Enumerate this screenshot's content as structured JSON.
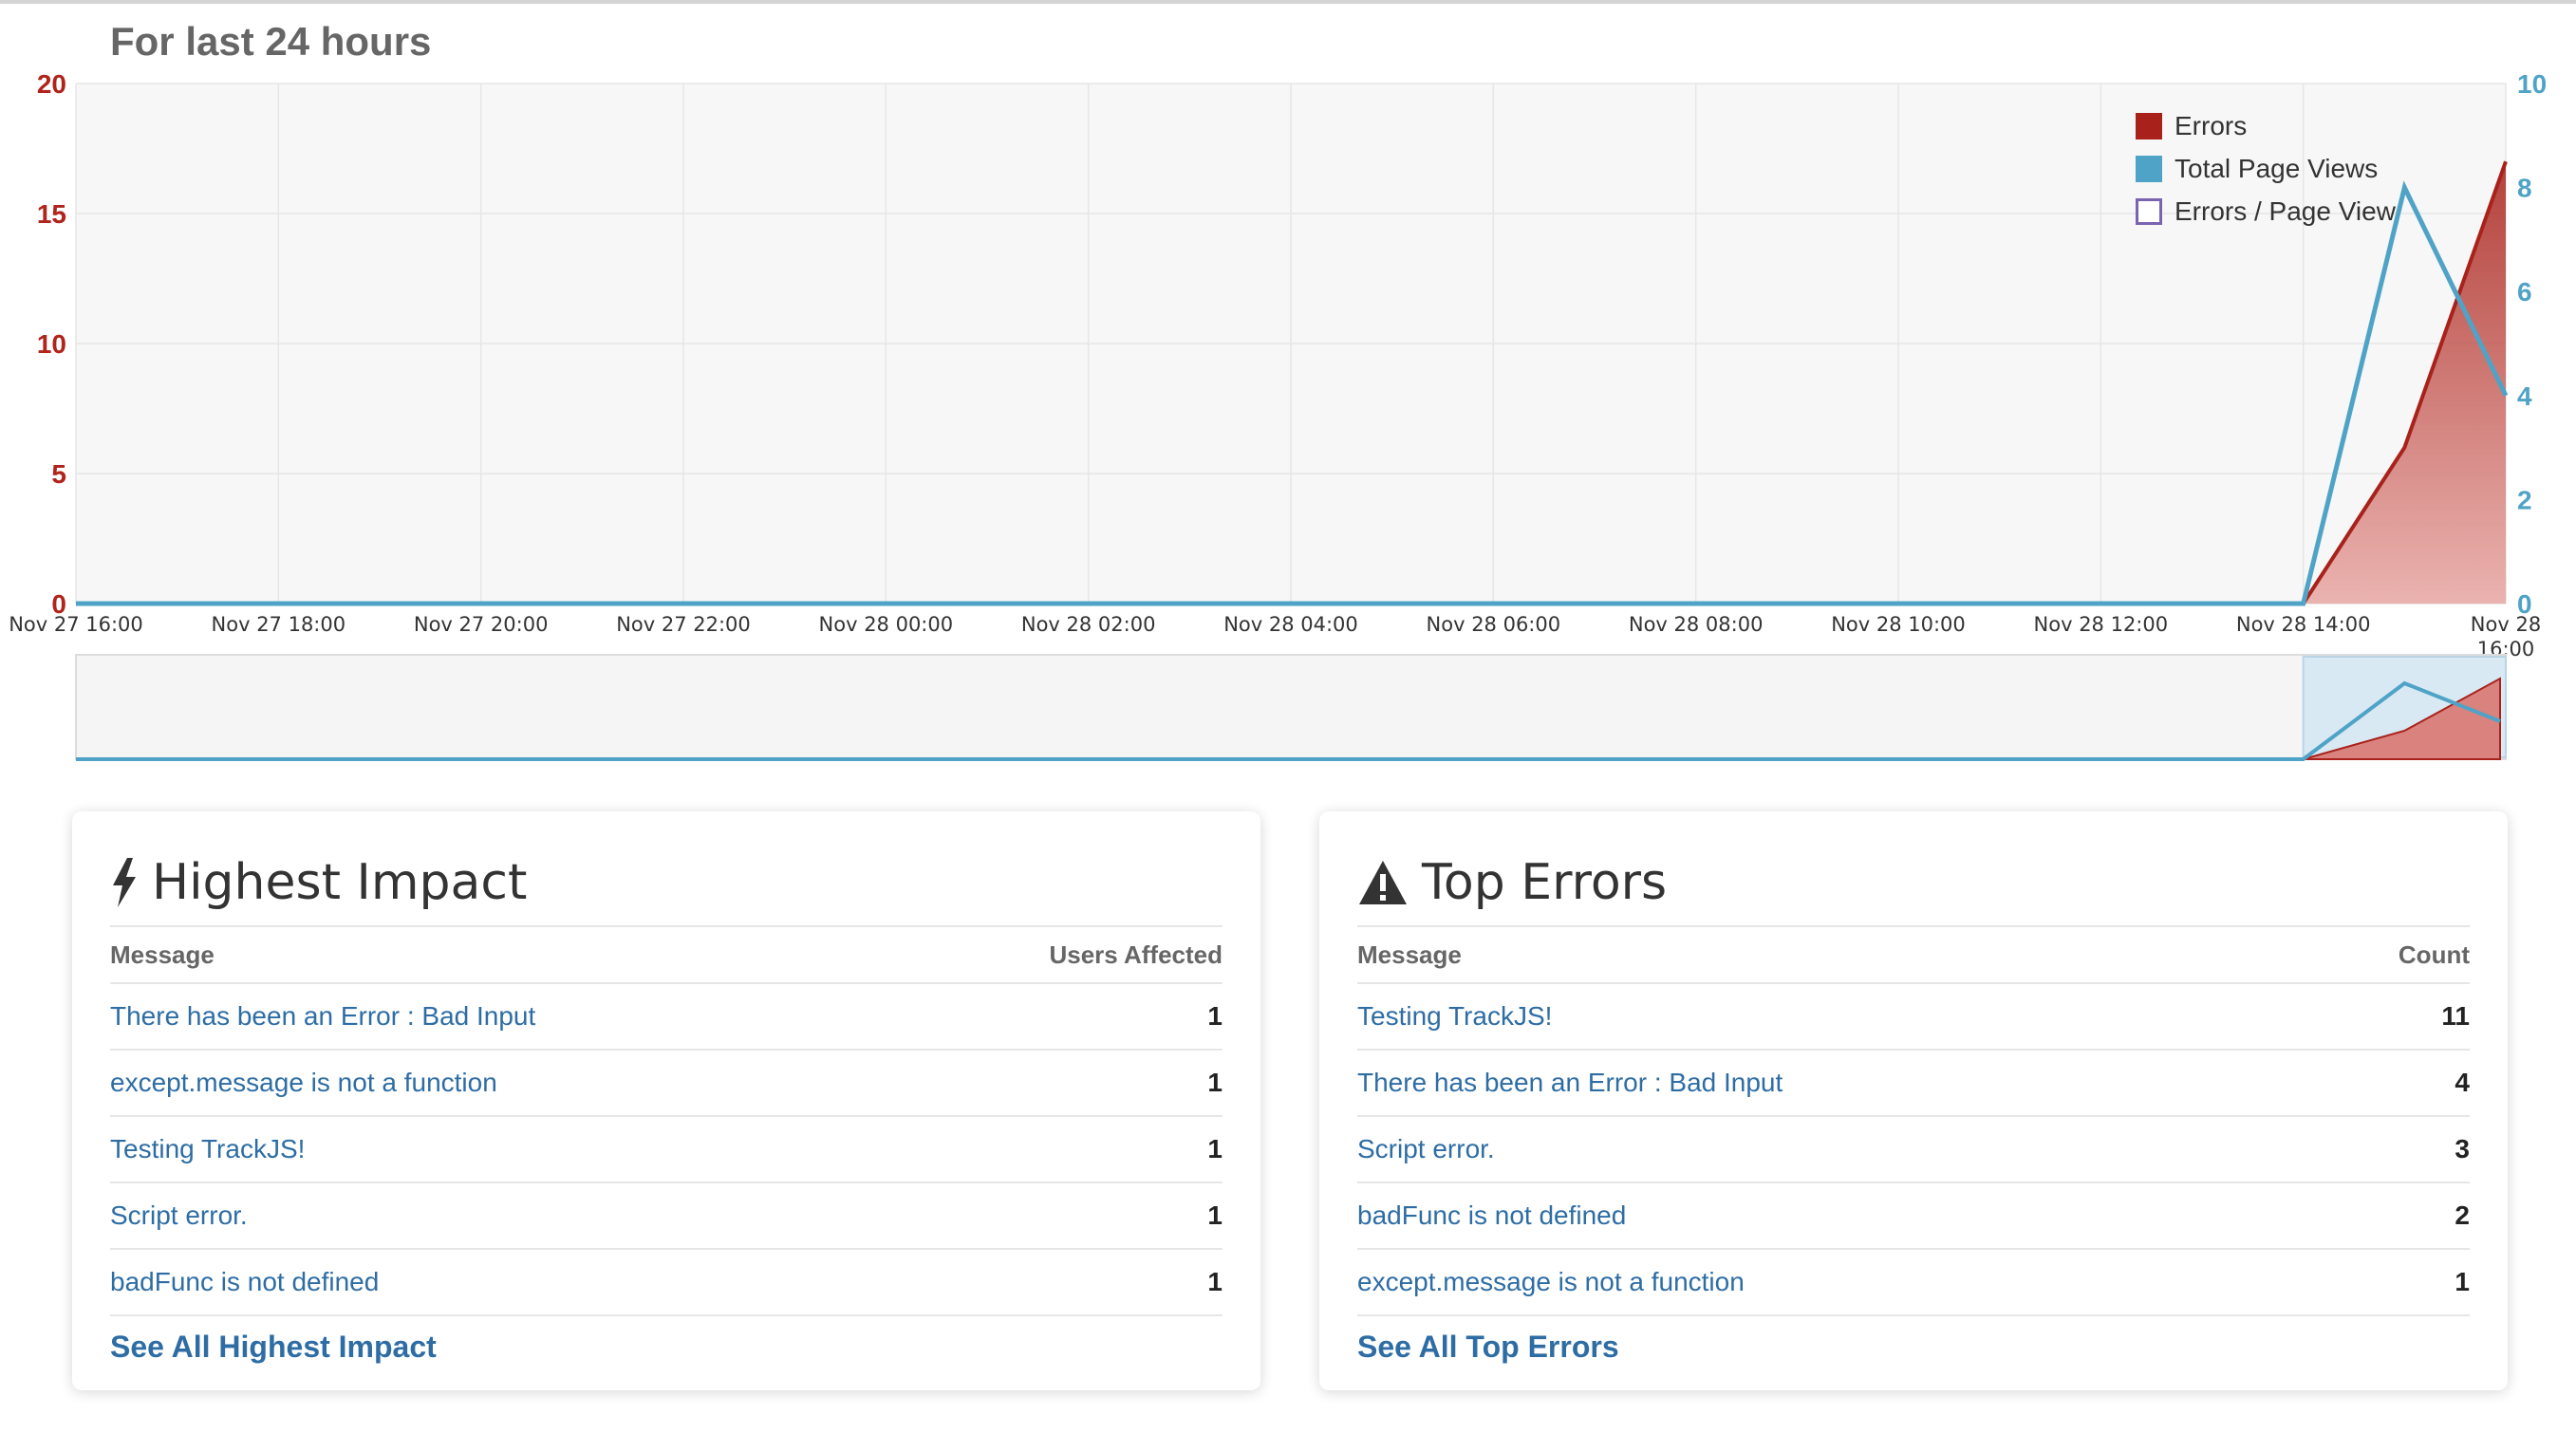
{
  "chart_title": "For last 24 hours",
  "chart_data": {
    "type": "area",
    "x": [
      "Nov 27 16:00",
      "Nov 27 18:00",
      "Nov 27 20:00",
      "Nov 27 22:00",
      "Nov 28 00:00",
      "Nov 28 02:00",
      "Nov 28 04:00",
      "Nov 28 06:00",
      "Nov 28 08:00",
      "Nov 28 10:00",
      "Nov 28 12:00",
      "Nov 28 14:00",
      "Nov 28 15:00",
      "Nov 28 16:00"
    ],
    "tick_labels": [
      "Nov 27 16:00",
      "Nov 27 18:00",
      "Nov 27 20:00",
      "Nov 27 22:00",
      "Nov 28 00:00",
      "Nov 28 02:00",
      "Nov 28 04:00",
      "Nov 28 06:00",
      "Nov 28 08:00",
      "Nov 28 10:00",
      "Nov 28 12:00",
      "Nov 28 14:00",
      "Nov 28 16:00"
    ],
    "left_axis": {
      "ticks": [
        "0",
        "5",
        "10",
        "15",
        "20"
      ],
      "ylim": [
        0,
        20
      ],
      "color": "#b0241c"
    },
    "right_axis": {
      "ticks": [
        "0",
        "2",
        "4",
        "6",
        "8",
        "10"
      ],
      "ylim": [
        0,
        10
      ],
      "color": "#4fa3c6"
    },
    "series": [
      {
        "name": "Errors",
        "color": "#a8221b",
        "axis": "left",
        "style": "area",
        "values": [
          0,
          0,
          0,
          0,
          0,
          0,
          0,
          0,
          0,
          0,
          0,
          0,
          6,
          17
        ]
      },
      {
        "name": "Total Page Views",
        "color": "#4fa3c6",
        "axis": "right",
        "style": "line",
        "values": [
          0,
          0,
          0,
          0,
          0,
          0,
          0,
          0,
          0,
          0,
          0,
          0,
          8,
          4
        ]
      },
      {
        "name": "Errors / Page View",
        "color": "#7a64b0",
        "axis": "right",
        "style": "line",
        "values": []
      }
    ],
    "legend_position": "top-right",
    "grid": true,
    "navigator": true
  },
  "highest_impact": {
    "title": "Highest Impact",
    "col_message": "Message",
    "col_value": "Users Affected",
    "rows": [
      {
        "message": "There has been an Error : Bad Input",
        "value": "1"
      },
      {
        "message": "except.message is not a function",
        "value": "1"
      },
      {
        "message": "Testing TrackJS!",
        "value": "1"
      },
      {
        "message": "Script error.",
        "value": "1"
      },
      {
        "message": "badFunc is not defined",
        "value": "1"
      }
    ],
    "see_all": "See All Highest Impact"
  },
  "top_errors": {
    "title": "Top Errors",
    "col_message": "Message",
    "col_value": "Count",
    "rows": [
      {
        "message": "Testing TrackJS!",
        "value": "11"
      },
      {
        "message": "There has been an Error : Bad Input",
        "value": "4"
      },
      {
        "message": "Script error.",
        "value": "3"
      },
      {
        "message": "badFunc is not defined",
        "value": "2"
      },
      {
        "message": "except.message is not a function",
        "value": "1"
      }
    ],
    "see_all": "See All Top Errors"
  },
  "icons": {
    "highest_impact": "lightning-bolt-icon",
    "top_errors": "warning-triangle-icon"
  }
}
